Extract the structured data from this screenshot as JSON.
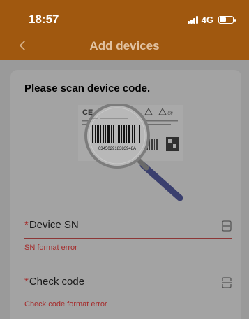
{
  "status_bar": {
    "time": "18:57",
    "network": "4G"
  },
  "header": {
    "title": "Add devices"
  },
  "instruction": "Please scan device code.",
  "illustration": {
    "barcode_text": "034502918383948A"
  },
  "fields": [
    {
      "label": "Device SN",
      "required_mark": "*",
      "error": "SN format error"
    },
    {
      "label": "Check code",
      "required_mark": "*",
      "error": "Check code format error"
    }
  ],
  "colors": {
    "header_bg": "#a0580f",
    "error": "#a52b2b",
    "overlay_bg": "#9a9a9a"
  },
  "icons": {
    "back": "chevron-left-icon",
    "scan": "scan-icon",
    "signal": "signal-icon",
    "battery": "battery-icon"
  }
}
